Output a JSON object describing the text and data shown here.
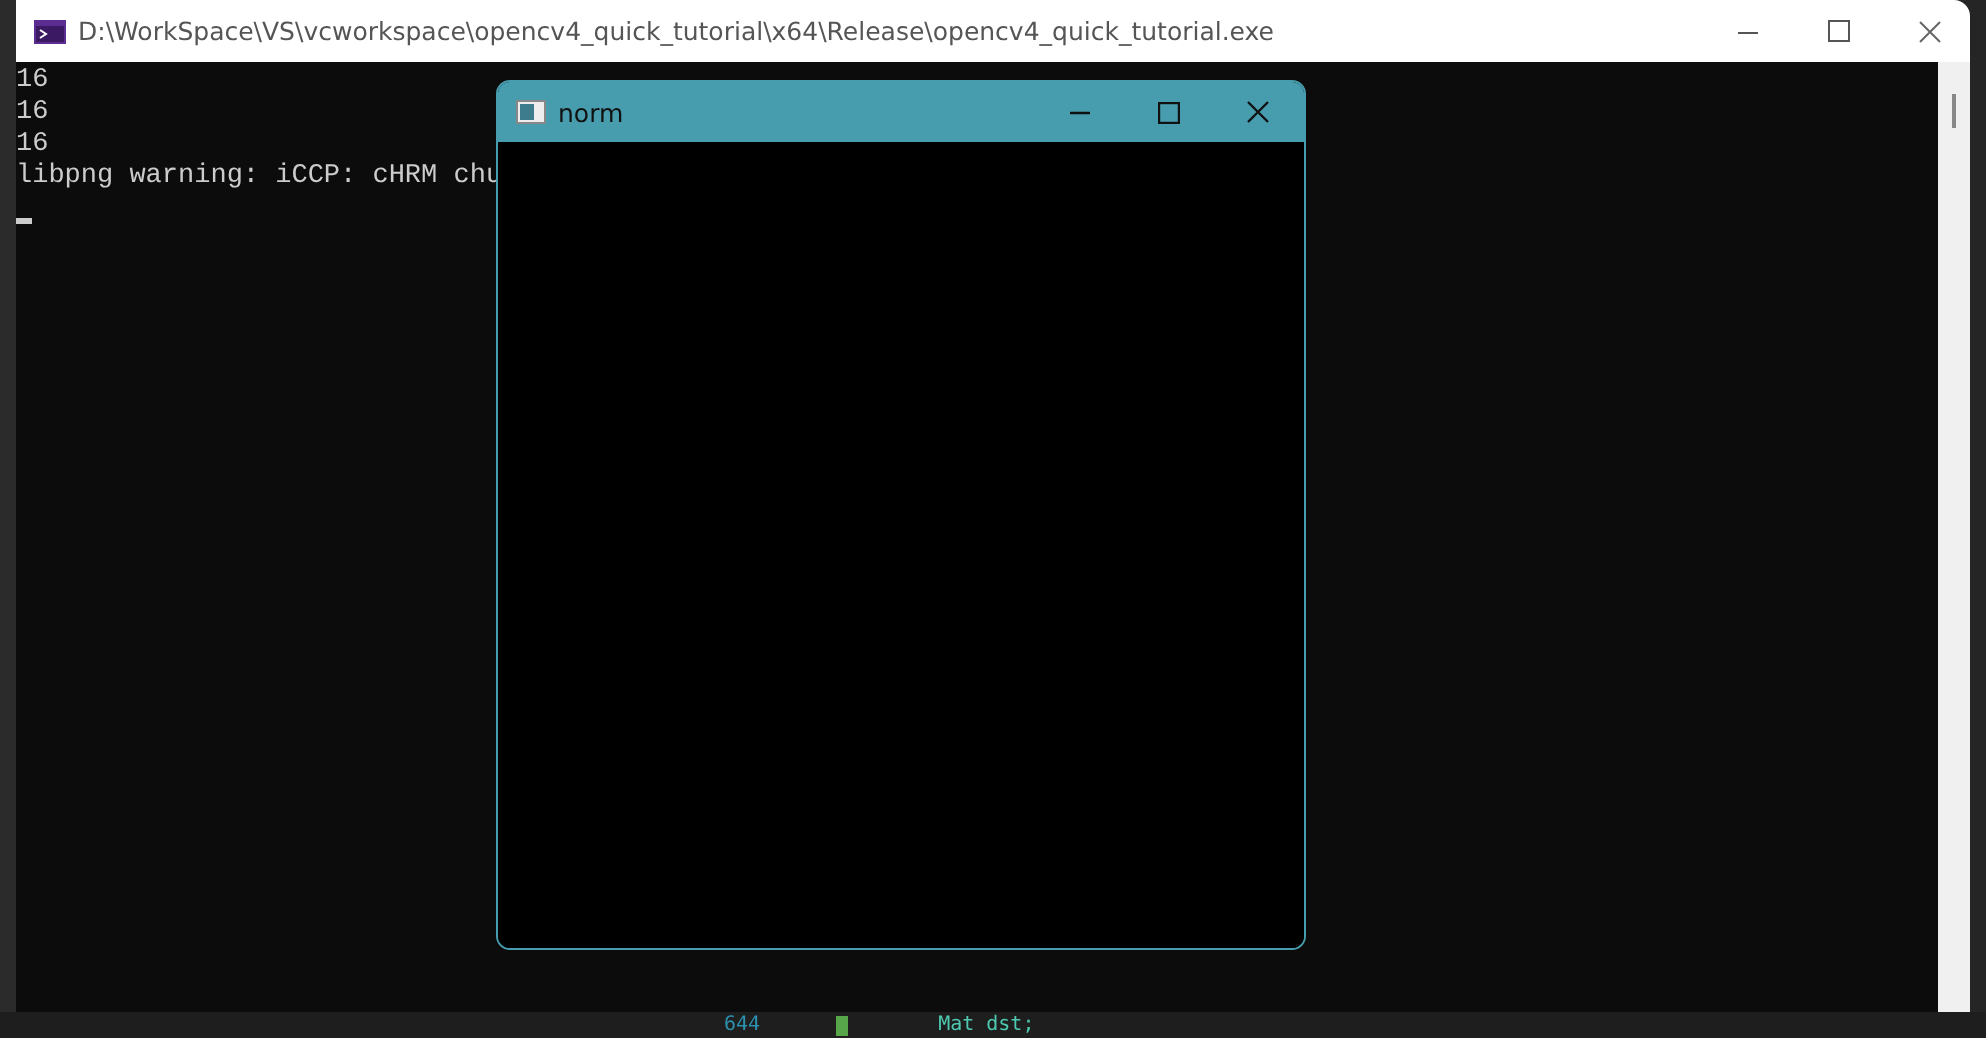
{
  "console_window": {
    "title": "D:\\WorkSpace\\VS\\vcworkspace\\opencv4_quick_tutorial\\x64\\Release\\opencv4_quick_tutorial.exe",
    "lines": [
      "16",
      "16",
      "16",
      "libpng warning: iCCP: cHRM chu"
    ],
    "cursor": true
  },
  "image_window": {
    "title": "norm"
  },
  "editor_behind": {
    "line_number": "644",
    "code": "Mat dst;"
  }
}
